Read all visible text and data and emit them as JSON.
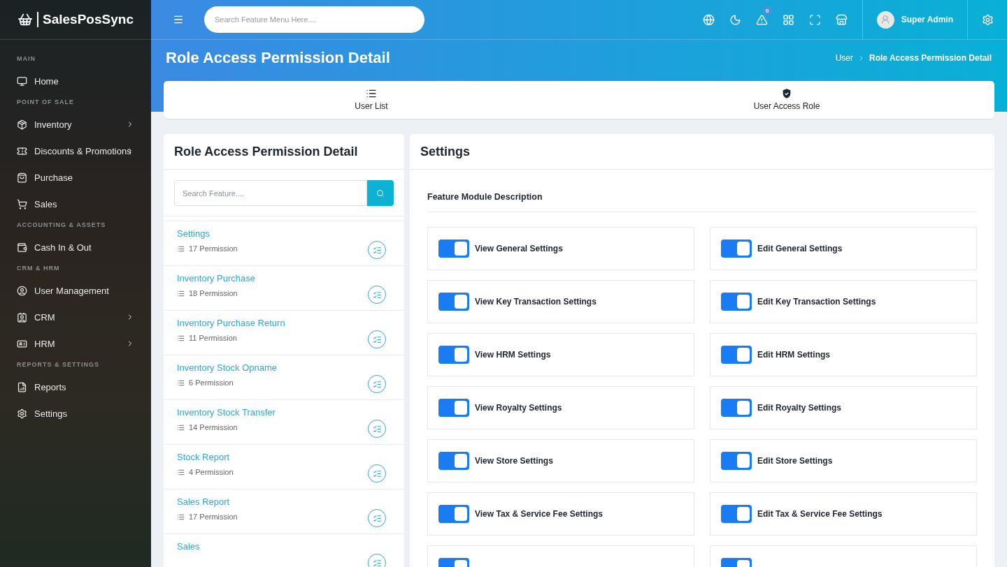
{
  "brand": {
    "name": "SalesPosSync"
  },
  "sidebar": {
    "items": [
      {
        "kind": "section",
        "label": "MAIN"
      },
      {
        "kind": "link",
        "label": "Home",
        "has_submenu": false
      },
      {
        "kind": "section",
        "label": "POINT OF SALE"
      },
      {
        "kind": "link",
        "label": "Inventory",
        "has_submenu": true
      },
      {
        "kind": "link",
        "label": "Discounts & Promotions",
        "has_submenu": true
      },
      {
        "kind": "link",
        "label": "Purchase",
        "has_submenu": false
      },
      {
        "kind": "link",
        "label": "Sales",
        "has_submenu": false
      },
      {
        "kind": "section",
        "label": "ACCOUNTING & ASSETS"
      },
      {
        "kind": "link",
        "label": "Cash In & Out",
        "has_submenu": false
      },
      {
        "kind": "section",
        "label": "CRM & HRM"
      },
      {
        "kind": "link",
        "label": "User Management",
        "has_submenu": false
      },
      {
        "kind": "link",
        "label": "CRM",
        "has_submenu": true
      },
      {
        "kind": "link",
        "label": "HRM",
        "has_submenu": true
      },
      {
        "kind": "section",
        "label": "REPORTS & SETTINGS"
      },
      {
        "kind": "link",
        "label": "Reports",
        "has_submenu": false
      },
      {
        "kind": "link",
        "label": "Settings",
        "has_submenu": false
      }
    ]
  },
  "topbar": {
    "search": {
      "placeholder": "Search Feature Menu Here...."
    },
    "notification_count": "0",
    "user": {
      "name": "Super Admin"
    }
  },
  "page": {
    "title": "Role Access Permission Detail",
    "breadcrumb": [
      "User",
      "Role Access Permission Detail"
    ]
  },
  "tabs": [
    {
      "label": "User List",
      "selected": false
    },
    {
      "label": "User Access Role",
      "selected": false
    }
  ],
  "feature_panel": {
    "title": "Role Access Permission Detail",
    "search": {
      "placeholder": "Search Feature...."
    },
    "features": [
      {
        "name": "Settings",
        "count": "17 Permission"
      },
      {
        "name": "Inventory Purchase",
        "count": "18 Permission"
      },
      {
        "name": "Inventory Purchase Return",
        "count": "11 Permission"
      },
      {
        "name": "Inventory Stock Opname",
        "count": "6 Permission"
      },
      {
        "name": "Inventory Stock Transfer",
        "count": "14 Permission"
      },
      {
        "name": "Stock Report",
        "count": "4 Permission"
      },
      {
        "name": "Sales Report",
        "count": "17 Permission"
      },
      {
        "name": "Sales"
      }
    ]
  },
  "settings_panel": {
    "title": "Settings",
    "subtitle": "Feature Module Description",
    "permissions": [
      {
        "label": "View General Settings",
        "on": true
      },
      {
        "label": "Edit General Settings",
        "on": true
      },
      {
        "label": "View Key Transaction Settings",
        "on": true
      },
      {
        "label": "Edit Key Transaction Settings",
        "on": true
      },
      {
        "label": "View HRM Settings",
        "on": true
      },
      {
        "label": "Edit HRM Settings",
        "on": true
      },
      {
        "label": "View Royalty Settings",
        "on": true
      },
      {
        "label": "Edit Royalty Settings",
        "on": true
      },
      {
        "label": "View Store Settings",
        "on": true
      },
      {
        "label": "Edit Store Settings",
        "on": true
      },
      {
        "label": "View Tax & Service Fee Settings",
        "on": true
      },
      {
        "label": "Edit Tax & Service Fee Settings",
        "on": true
      },
      {
        "on": true
      },
      {
        "on": true
      }
    ]
  }
}
